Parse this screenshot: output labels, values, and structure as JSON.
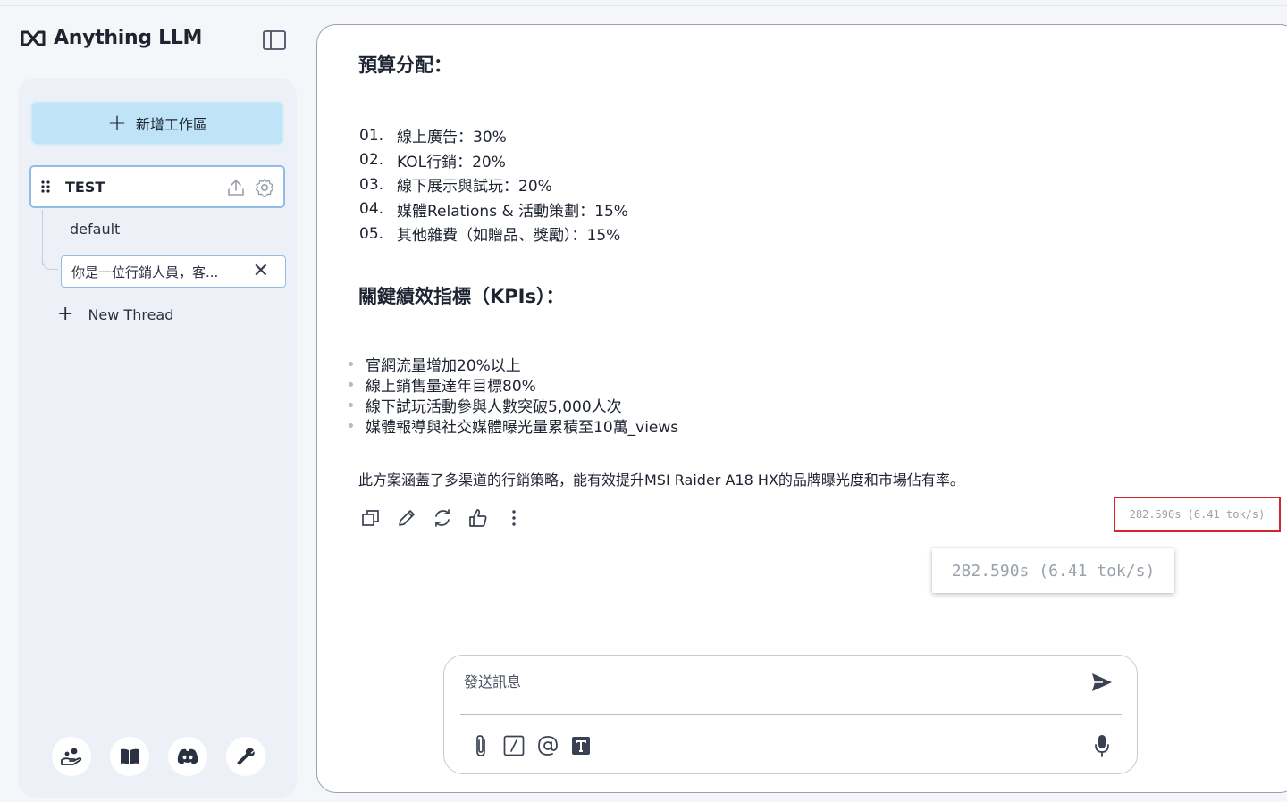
{
  "app": {
    "name": "Anything LLM"
  },
  "sidebar": {
    "new_workspace_label": "新增工作區",
    "workspace": {
      "name": "TEST"
    },
    "threads": [
      {
        "label": "default"
      },
      {
        "label": "你是一位行銷人員，客..."
      }
    ],
    "new_thread_label": "New Thread",
    "footer_icons": [
      "community-hub-icon",
      "docs-book-icon",
      "discord-icon",
      "wrench-settings-icon"
    ]
  },
  "chat": {
    "budget_heading": "預算分配：",
    "budget_items": [
      {
        "num": "01.",
        "text": "線上廣告：30%"
      },
      {
        "num": "02.",
        "text": "KOL行銷：20%"
      },
      {
        "num": "03.",
        "text": "線下展示與試玩：20%"
      },
      {
        "num": "04.",
        "text": "媒體Relations & 活動策劃：15%"
      },
      {
        "num": "05.",
        "text": "其他雜費（如贈品、獎勵）：15%"
      }
    ],
    "kpi_heading": "關鍵績效指標（KPIs）：",
    "kpi_items": [
      "官網流量增加20%以上",
      "線上銷售量達年目標80%",
      "線下試玩活動參與人數突破5,000人次",
      "媒體報導與社交媒體曝光量累積至10萬_views"
    ],
    "summary": "此方案涵蓋了多渠道的行銷策略，能有效提升MSI Raider A18 HX的品牌曝光度和市場佔有率。",
    "metrics": "282.590s (6.41 tok/s)",
    "metrics_zoom": "282.590s (6.41 tok/s)"
  },
  "composer": {
    "placeholder": "發送訊息"
  },
  "colors": {
    "accent": "#bfe3f7",
    "selection_border": "#8fbde8",
    "highlight_red": "#d0262c"
  }
}
